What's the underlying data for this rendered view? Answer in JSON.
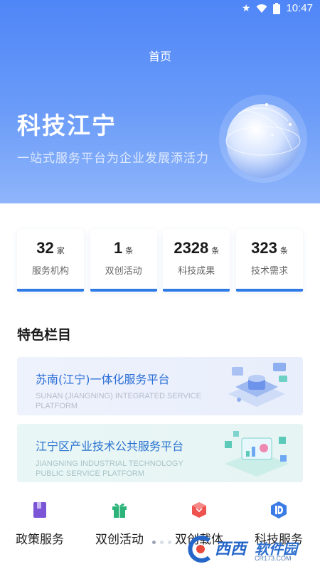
{
  "status_bar": {
    "time": "10:47",
    "icons": [
      "star-icon",
      "wifi-icon",
      "battery-icon"
    ]
  },
  "header": {
    "title": "首页"
  },
  "hero": {
    "title": "科技江宁",
    "subtitle": "一站式服务平台为企业发展添活力"
  },
  "stats": [
    {
      "value": "32",
      "unit": "家",
      "label": "服务机构"
    },
    {
      "value": "1",
      "unit": "条",
      "label": "双创活动"
    },
    {
      "value": "2328",
      "unit": "条",
      "label": "科技成果"
    },
    {
      "value": "323",
      "unit": "条",
      "label": "技术需求"
    }
  ],
  "featured": {
    "title": "特色栏目",
    "banners": [
      {
        "title": "苏南(江宁)一体化服务平台",
        "subtitle": "SUNAN (JIANGNING) INTEGRATED SERVICE PLATFORM"
      },
      {
        "title": "江宁区产业技术公共服务平台",
        "subtitle": "JIANGNING INDUSTRIAL TECHNOLOGY PUBLIC SERVICE PLATFORM"
      }
    ]
  },
  "bottom_nav": [
    {
      "label": "政策服务",
      "icon": "policy-book-icon",
      "color": "#7b55d6"
    },
    {
      "label": "双创活动",
      "icon": "gift-icon",
      "color": "#2cb37a"
    },
    {
      "label": "双创载体",
      "icon": "cube-icon",
      "color": "#ef5350"
    },
    {
      "label": "科技服务",
      "icon": "tech-service-icon",
      "color": "#3b7be6"
    }
  ],
  "watermark": {
    "brand": "西西",
    "suffix": "软件园",
    "url": "CR173.COM"
  },
  "colors": {
    "hero_top": "#4f86f7",
    "accent": "#2f7be6",
    "banner_title": "#2b6fd6"
  }
}
